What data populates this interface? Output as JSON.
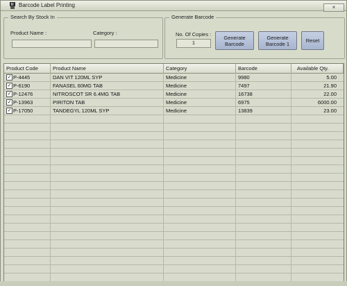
{
  "window": {
    "title": "Barcode Label Printing",
    "close_label": "×"
  },
  "search_group": {
    "legend": "Search By Stock In",
    "product_name_label": "Product Name :",
    "product_name_value": "",
    "category_label": "Category :",
    "category_value": ""
  },
  "generate_group": {
    "legend": "Generate Barcode",
    "copies_label": "No. Of Copies :",
    "copies_value": "1",
    "generate_button": "Generate Barcode",
    "generate1_button": "Generate Barcode 1",
    "reset_button": "Reset"
  },
  "table": {
    "columns": [
      "Product Code",
      "Product Name",
      "Category",
      "Barcode",
      "Available Qty."
    ],
    "rows": [
      {
        "checked": true,
        "code": "P-4445",
        "name": "DAN VIT 120ML SYP",
        "category": "Medicine",
        "barcode": "9980",
        "qty": "5.00"
      },
      {
        "checked": true,
        "code": "P-6190",
        "name": "FANASEL 60MG TAB",
        "category": "Medicine",
        "barcode": "7497",
        "qty": "21.90"
      },
      {
        "checked": true,
        "code": "P-12476",
        "name": "NITROSCOT SR 6.4MG TAB",
        "category": "Medicine",
        "barcode": "16738",
        "qty": "22.00"
      },
      {
        "checked": true,
        "code": "P-13963",
        "name": "PIRITON TAB",
        "category": "Medicine",
        "barcode": "6975",
        "qty": "6000.00"
      },
      {
        "checked": true,
        "code": "P-17050",
        "name": "TANDEGYL 120ML SYP",
        "category": "Medicine",
        "barcode": "13839",
        "qty": "23.00"
      }
    ],
    "empty_row_count": 20
  }
}
